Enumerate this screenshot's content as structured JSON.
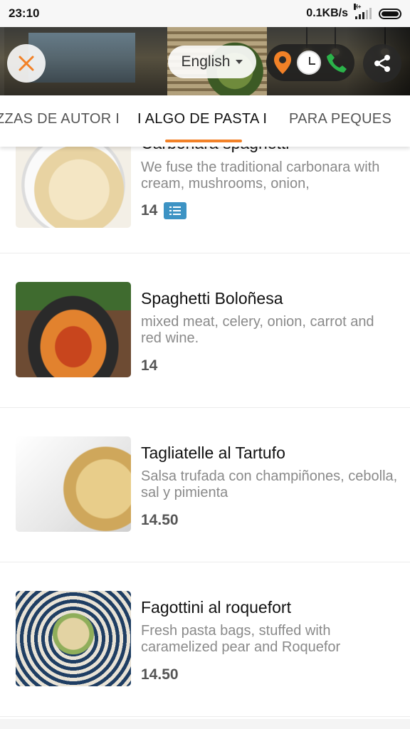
{
  "status_bar": {
    "time": "23:10",
    "network_speed": "0.1KB/s",
    "network_type": "H+"
  },
  "header": {
    "close_icon": "close-x-icon",
    "language": "English",
    "info_icons": [
      "location-pin-icon",
      "clock-icon",
      "phone-icon"
    ],
    "share_icon": "share-icon",
    "accent_color": "#f28127"
  },
  "tabs": [
    {
      "label": "ZZAS DE AUTOR I",
      "active": false
    },
    {
      "label": "I ALGO DE PASTA I",
      "active": true
    },
    {
      "label": "PARA PEQUES",
      "active": false
    }
  ],
  "items": [
    {
      "name": "Carbonara spaghetti",
      "description": "We fuse the traditional carbonara with cream, mushrooms, onion,",
      "price": "14",
      "has_menu_badge": true
    },
    {
      "name": "Spaghetti Boloñesa",
      "description": "mixed meat, celery, onion, carrot and red wine.",
      "price": "14"
    },
    {
      "name": "Tagliatelle al Tartufo",
      "description": "Salsa trufada con champiñones, cebolla, sal y pimienta",
      "price": "14.50"
    },
    {
      "name": "Fagottini al roquefort",
      "description": "Fresh pasta bags, stuffed with caramelized pear and Roquefor",
      "price": "14.50"
    }
  ]
}
